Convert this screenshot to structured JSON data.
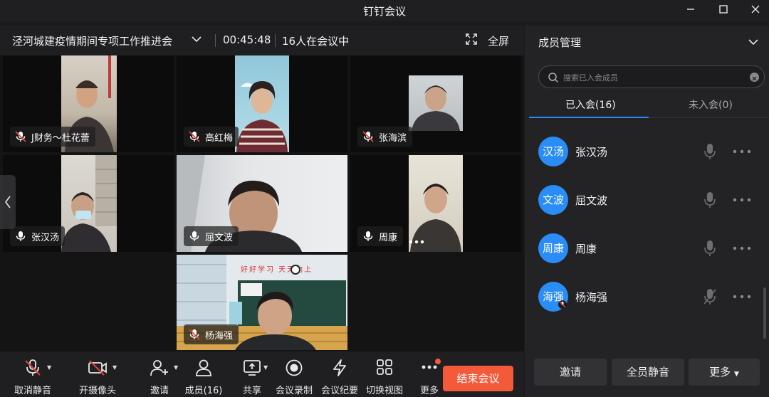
{
  "window": {
    "title": "钉钉会议"
  },
  "meeting": {
    "title": "泾河城建疫情期间专项工作推进会",
    "timer": "00:45:48",
    "participants_status": "16人在会议中",
    "fullscreen_label": "全屏"
  },
  "tiles": [
    {
      "name": "J财务～杜花蕾",
      "muted": true
    },
    {
      "name": "高红梅",
      "muted": true
    },
    {
      "name": "张海滨",
      "muted": true
    },
    {
      "name": "张汉汤",
      "muted": false
    },
    {
      "name": "屈文波",
      "muted": false
    },
    {
      "name": "周康",
      "muted": false
    },
    {
      "name": "杨海强",
      "muted": true
    }
  ],
  "classroom_banner": "好好学习 天天向上",
  "toolbar": {
    "unmute": "取消静音",
    "camera": "开摄像头",
    "invite": "邀请",
    "members": "成员(16)",
    "share": "共享",
    "record": "会议录制",
    "minutes": "会议纪要",
    "switch_view": "切换视图",
    "more": "更多",
    "end": "结束会议"
  },
  "panel": {
    "title": "成员管理",
    "search_placeholder": "搜索已入会成员",
    "tab_joined": "已入会(16)",
    "tab_not_joined": "未入会(0)",
    "members": [
      {
        "avatar": "汉汤",
        "name": "张汉汤",
        "muted": false
      },
      {
        "avatar": "文波",
        "name": "屈文波",
        "muted": false
      },
      {
        "avatar": "周康",
        "name": "周康",
        "muted": false
      },
      {
        "avatar": "海强",
        "name": "杨海强",
        "muted": true
      }
    ],
    "buttons": {
      "invite": "邀请",
      "mute_all": "全员静音",
      "more": "更多"
    }
  },
  "colors": {
    "accent": "#2f87ff",
    "avatar": "#2a8cf5",
    "end_button": "#f25a3a",
    "muted_icon": "#e2473a"
  }
}
